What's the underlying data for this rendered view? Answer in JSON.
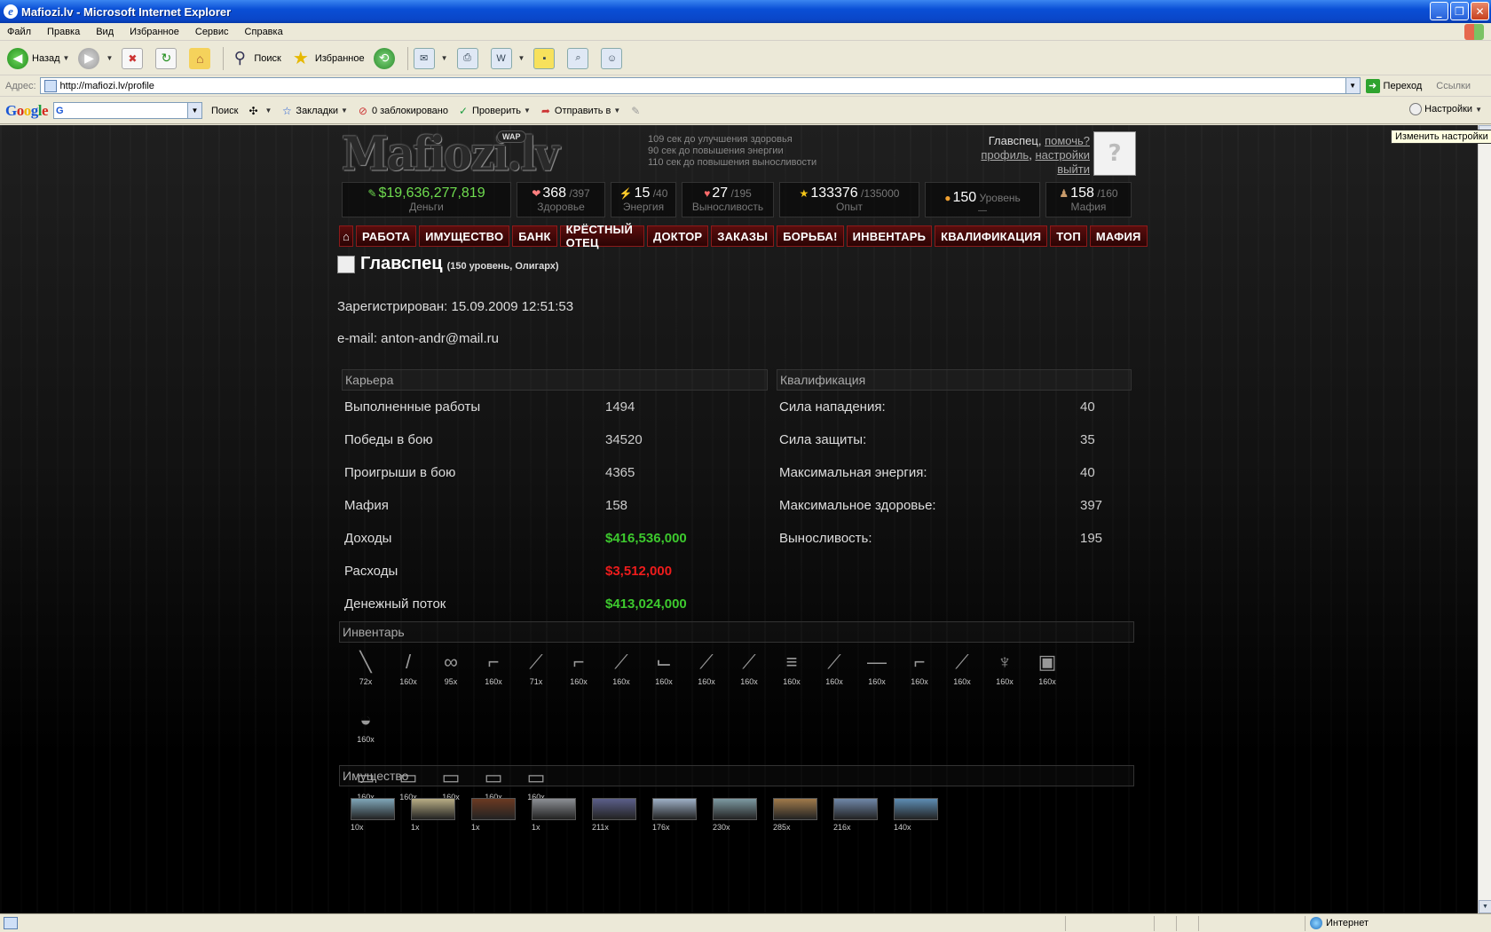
{
  "window": {
    "title": "Mafiozi.lv - Microsoft Internet Explorer"
  },
  "menu": [
    "Файл",
    "Правка",
    "Вид",
    "Избранное",
    "Сервис",
    "Справка"
  ],
  "toolbar": {
    "back": "Назад",
    "search": "Поиск",
    "favorites": "Избранное"
  },
  "address": {
    "label": "Адрес:",
    "url": "http://mafiozi.lv/profile",
    "go": "Переход",
    "links": "Ссылки"
  },
  "google": {
    "logo": "Google",
    "query": "G",
    "search": "Поиск",
    "bookmarks": "Закладки",
    "blocked": "0 заблокировано",
    "check": "Проверить",
    "send": "Отправить в",
    "settings": "Настройки",
    "tooltip": "Изменить настройки"
  },
  "site": {
    "logo": "Mafiozi.lv",
    "wap": "WAP",
    "timers": [
      "109 сек до улучшения здоровья",
      "90 сек до повышения энергии",
      "110 сек до повышения выносливости"
    ],
    "user": {
      "name": "Главспец",
      "help": "помочь?",
      "profile": "профиль",
      "settings": "настройки",
      "logout": "выйти"
    },
    "stats": {
      "money": {
        "value": "$19,636,277,819",
        "label": "Деньги"
      },
      "health": {
        "value": "368",
        "max": "/397",
        "label": "Здоровье"
      },
      "energy": {
        "value": "15",
        "max": "/40",
        "label": "Энергия"
      },
      "stamina": {
        "value": "27",
        "max": "/195",
        "label": "Выносливость"
      },
      "exp": {
        "value": "133376",
        "max": "/135000",
        "label": "Опыт"
      },
      "level": {
        "value": "150",
        "label": "Уровень",
        "extra": "—"
      },
      "mafia": {
        "value": "158",
        "max": "/160",
        "label": "Мафия"
      }
    },
    "nav": [
      "РАБОТА",
      "ИМУЩЕСТВО",
      "БАНК",
      "КРЁСТНЫЙ ОТЕЦ",
      "ДОКТОР",
      "ЗАКАЗЫ",
      "БОРЬБА!",
      "ИНВЕНТАРЬ",
      "КВАЛИФИКАЦИЯ",
      "ТОП",
      "МАФИЯ"
    ],
    "profile": {
      "name": "Главспец",
      "subtitle": "(150 уровень, Олигарх)",
      "registered": "Зарегистрирован: 15.09.2009 12:51:53",
      "email": "e-mail: anton-andr@mail.ru"
    },
    "career": {
      "title": "Карьера",
      "rows": [
        {
          "k": "Выполненные работы",
          "v": "1494",
          "t": ""
        },
        {
          "k": "Победы в бою",
          "v": "34520",
          "t": ""
        },
        {
          "k": "Проигрыши в бою",
          "v": "4365",
          "t": ""
        },
        {
          "k": "Мафия",
          "v": "158",
          "t": ""
        },
        {
          "k": "Доходы",
          "v": "$416,536,000",
          "t": "pos"
        },
        {
          "k": "Расходы",
          "v": "$3,512,000",
          "t": "neg"
        },
        {
          "k": "Денежный поток",
          "v": "$413,024,000",
          "t": "pos"
        }
      ]
    },
    "qualification": {
      "title": "Квалификация",
      "rows": [
        {
          "k": "Сила нападения:",
          "v": "40"
        },
        {
          "k": "Сила защиты:",
          "v": "35"
        },
        {
          "k": "Максимальная энергия:",
          "v": "40"
        },
        {
          "k": "Максимальное здоровье:",
          "v": "397"
        },
        {
          "k": "Выносливость:",
          "v": "195"
        }
      ]
    },
    "inventory": {
      "title": "Инвентарь",
      "items": [
        {
          "icon": "knife-icon",
          "glyph": "╲",
          "count": "72x"
        },
        {
          "icon": "bat-icon",
          "glyph": "/",
          "count": "160x"
        },
        {
          "icon": "knuckles-icon",
          "glyph": "∞",
          "count": "95x"
        },
        {
          "icon": "crowbar-icon",
          "glyph": "⌐",
          "count": "160x"
        },
        {
          "icon": "shotgun-icon",
          "glyph": "⟋",
          "count": "71x"
        },
        {
          "icon": "pistol-icon",
          "glyph": "⌐",
          "count": "160x"
        },
        {
          "icon": "rifle-icon",
          "glyph": "⟋",
          "count": "160x"
        },
        {
          "icon": "uzi-icon",
          "glyph": "⌙",
          "count": "160x"
        },
        {
          "icon": "ak-icon",
          "glyph": "⟋",
          "count": "160x"
        },
        {
          "icon": "m16-icon",
          "glyph": "⟋",
          "count": "160x"
        },
        {
          "icon": "minigun-icon",
          "glyph": "≡",
          "count": "160x"
        },
        {
          "icon": "machinegun-icon",
          "glyph": "⟋",
          "count": "160x"
        },
        {
          "icon": "sniper-icon",
          "glyph": "—",
          "count": "160x"
        },
        {
          "icon": "smg-icon",
          "glyph": "⌐",
          "count": "160x"
        },
        {
          "icon": "assault-rifle-icon",
          "glyph": "⟋",
          "count": "160x"
        },
        {
          "icon": "grenade-launcher-icon",
          "glyph": "♆",
          "count": "160x"
        },
        {
          "icon": "vest-icon",
          "glyph": "▣",
          "count": "160x"
        },
        {
          "icon": "helmet-icon",
          "glyph": "◒",
          "count": "160x"
        },
        {
          "icon": "car-sedan-icon",
          "glyph": "▭",
          "count": "160x"
        },
        {
          "icon": "car-sport-icon",
          "glyph": "▭",
          "count": "160x"
        },
        {
          "icon": "car-suv-icon",
          "glyph": "▭",
          "count": "160x"
        },
        {
          "icon": "car-hummer-icon",
          "glyph": "▭",
          "count": "160x"
        },
        {
          "icon": "car-military-icon",
          "glyph": "▭",
          "count": "160x"
        }
      ]
    },
    "property": {
      "title": "Имущество",
      "items": [
        {
          "count": "10x",
          "color": "#7fa6b8"
        },
        {
          "count": "1x",
          "color": "#b8ad85"
        },
        {
          "count": "1x",
          "color": "#6b3a22"
        },
        {
          "count": "1x",
          "color": "#8c8f95"
        },
        {
          "count": "211x",
          "color": "#5b5f8a"
        },
        {
          "count": "176x",
          "color": "#9eb0c6"
        },
        {
          "count": "230x",
          "color": "#7d9aa2"
        },
        {
          "count": "285x",
          "color": "#a07a4b"
        },
        {
          "count": "216x",
          "color": "#6f87a8"
        },
        {
          "count": "140x",
          "color": "#5d8db3"
        }
      ]
    }
  },
  "status": {
    "zone": "Интернет"
  }
}
